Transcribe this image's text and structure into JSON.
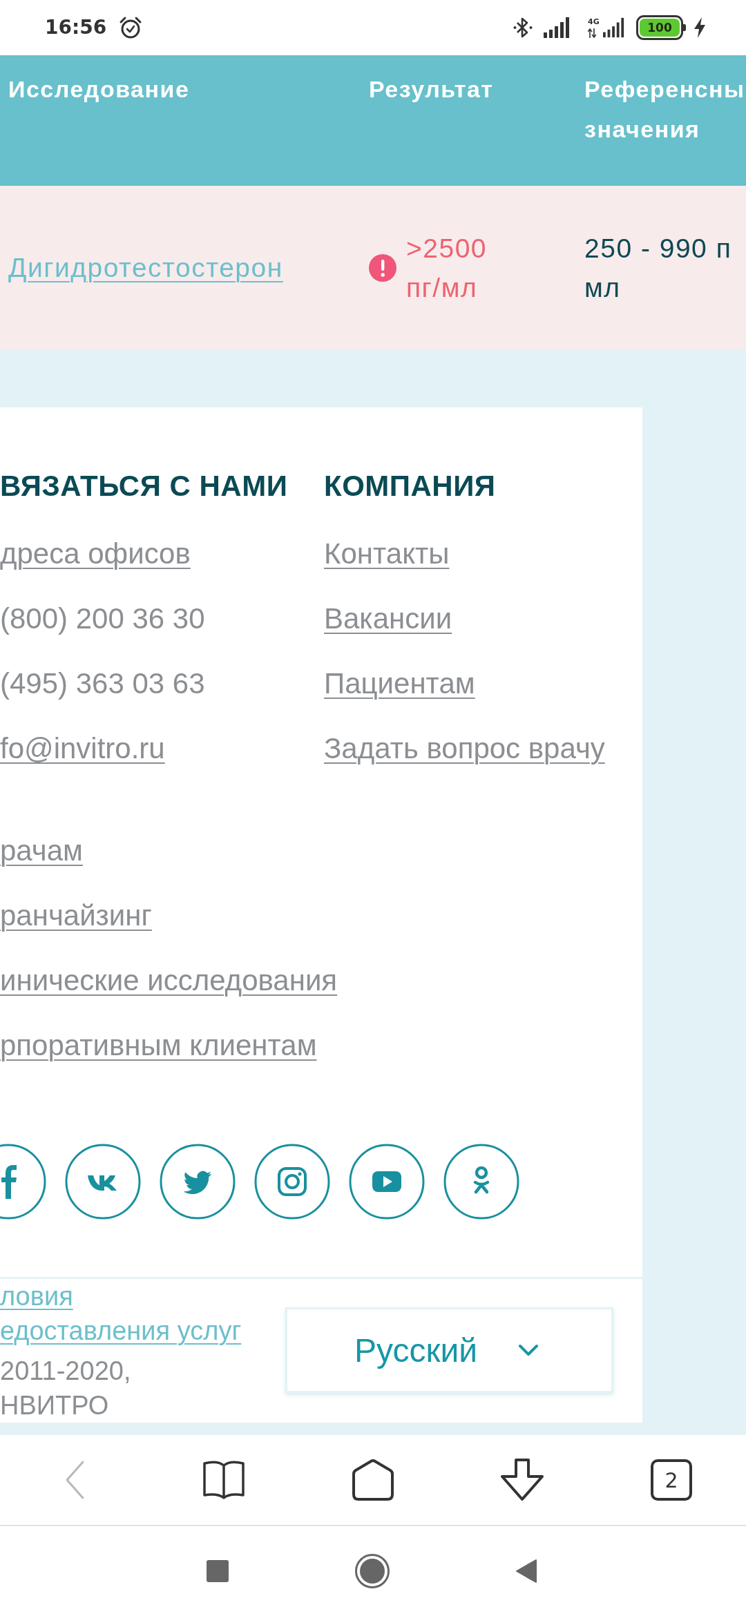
{
  "status_bar": {
    "time": "16:56",
    "network": "4G",
    "battery": "100",
    "charging": true
  },
  "table": {
    "columns": [
      "Исследование",
      "Результат",
      "Референсны значения"
    ],
    "rows": [
      {
        "test": "Дигидротестостерон",
        "result": ">2500 пг/мл",
        "abnormal": true,
        "reference": "250 - 990 п\nмл"
      }
    ]
  },
  "footer": {
    "contact": {
      "title": "ВЯЗАТЬСЯ С НАМИ",
      "items": [
        {
          "text": "дреса офисов",
          "kind": "link"
        },
        {
          "text": "(800) 200 36 30",
          "kind": "phone"
        },
        {
          "text": "(495) 363 03 63",
          "kind": "phone"
        },
        {
          "text": "fo@invitro.ru",
          "kind": "link"
        }
      ]
    },
    "company": {
      "title": "КОМПАНИЯ",
      "items": [
        {
          "text": "Контакты",
          "kind": "link"
        },
        {
          "text": "Вакансии",
          "kind": "link"
        },
        {
          "text": "Пациентам",
          "kind": "link"
        },
        {
          "text": "Задать вопрос врачу",
          "kind": "link"
        }
      ]
    },
    "more_links": [
      {
        "text": "рачам",
        "kind": "link"
      },
      {
        "text": "ранчайзинг",
        "kind": "link"
      },
      {
        "text": "инические исследования",
        "kind": "link"
      },
      {
        "text": "рпоративным клиентам",
        "kind": "link"
      }
    ],
    "legal_link": "ловия\nедоставления услуг",
    "copyright": "2011-2020,\nНВИТРО",
    "language": {
      "value": "Русский"
    }
  },
  "browser_toolbar": {
    "back_disabled": true,
    "tabs_count": "2"
  }
}
